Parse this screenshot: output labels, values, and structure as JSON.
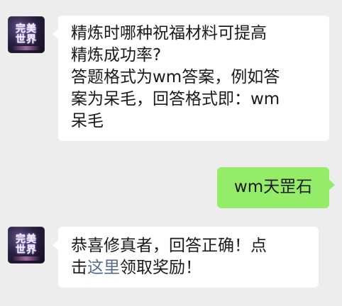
{
  "messages": [
    {
      "sender": "bot",
      "avatar": {
        "logo_lines": [
          "完美",
          "世界"
        ],
        "icon": "perfect-world-logo-icon"
      },
      "lines": [
        "精炼时哪种祝福材料可提高",
        "精炼成功率?",
        "答题格式为wm答案，例如答",
        "案为呆毛，回答格式即：wm",
        "呆毛"
      ]
    },
    {
      "sender": "user",
      "text": "wm天罡石"
    },
    {
      "sender": "bot",
      "avatar": {
        "logo_lines": [
          "完美",
          "世界"
        ],
        "icon": "perfect-world-logo-icon"
      },
      "line1": "恭喜修真者，回答正确！点",
      "line2_prefix": "击",
      "link_text": "这里",
      "line2_suffix": "领取奖励！"
    }
  ],
  "colors": {
    "background": "#ededed",
    "bot_bubble": "#ffffff",
    "user_bubble": "#95ec69",
    "link": "#576b95"
  }
}
